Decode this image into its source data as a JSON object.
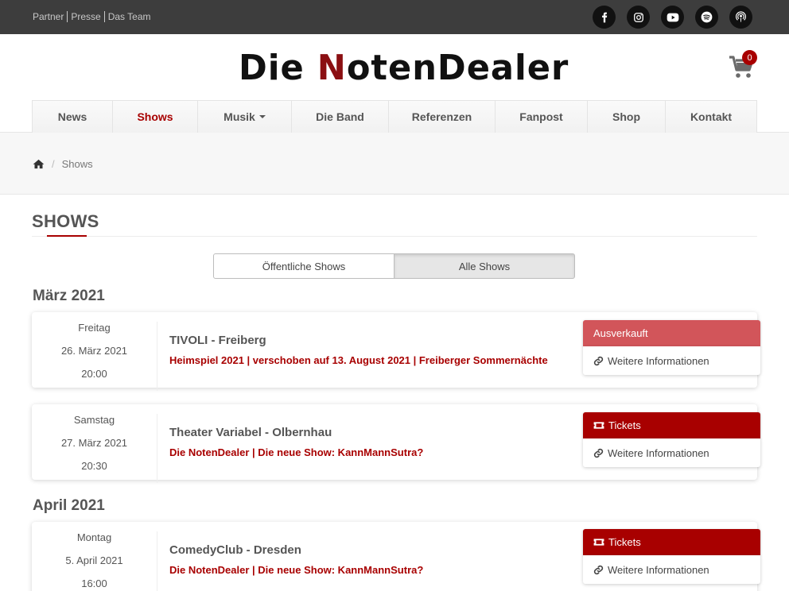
{
  "topbar": {
    "links": [
      "Partner",
      "Presse",
      "Das Team"
    ],
    "social": [
      "facebook-icon",
      "instagram-icon",
      "youtube-icon",
      "spotify-icon",
      "podcast-icon"
    ]
  },
  "header": {
    "logo_part1": "Die ",
    "logo_part2": "N",
    "logo_part3": "otenDealer",
    "cart_count": "0"
  },
  "nav": [
    {
      "label": "News"
    },
    {
      "label": "Shows",
      "active": true
    },
    {
      "label": "Musik",
      "dropdown": true
    },
    {
      "label": "Die Band"
    },
    {
      "label": "Referenzen"
    },
    {
      "label": "Fanpost"
    },
    {
      "label": "Shop"
    },
    {
      "label": "Kontakt"
    }
  ],
  "breadcrumb": {
    "home": "home-icon",
    "current": "Shows"
  },
  "page": {
    "title": "SHOWS",
    "filter_public": "Öffentliche Shows",
    "filter_all": "Alle Shows"
  },
  "months": [
    {
      "label": "März 2021"
    },
    {
      "label": "April 2021"
    }
  ],
  "shows": [
    {
      "weekday": "Freitag",
      "date": "26. März 2021",
      "time": "20:00",
      "venue": "TIVOLI - Freiberg",
      "info": "Heimspiel 2021 | verschoben auf 13. August 2021 | Freiberger Sommernächte",
      "primary": "Ausverkauft",
      "more": "Weitere Informationen"
    },
    {
      "weekday": "Samstag",
      "date": "27. März 2021",
      "time": "20:30",
      "venue": "Theater Variabel - Olbernhau",
      "info": "Die NotenDealer | Die neue Show: KannMannSutra?",
      "primary": "Tickets",
      "more": "Weitere Informationen"
    },
    {
      "weekday": "Montag",
      "date": "5. April 2021",
      "time": "16:00",
      "venue": "ComedyClub - Dresden",
      "info": "Die NotenDealer | Die neue Show: KannMannSutra?",
      "primary": "Tickets",
      "more": "Weitere Informationen"
    }
  ],
  "colors": {
    "accent": "#a80000",
    "sold_out": "#d2555a",
    "topbar": "#3d3d3d"
  }
}
